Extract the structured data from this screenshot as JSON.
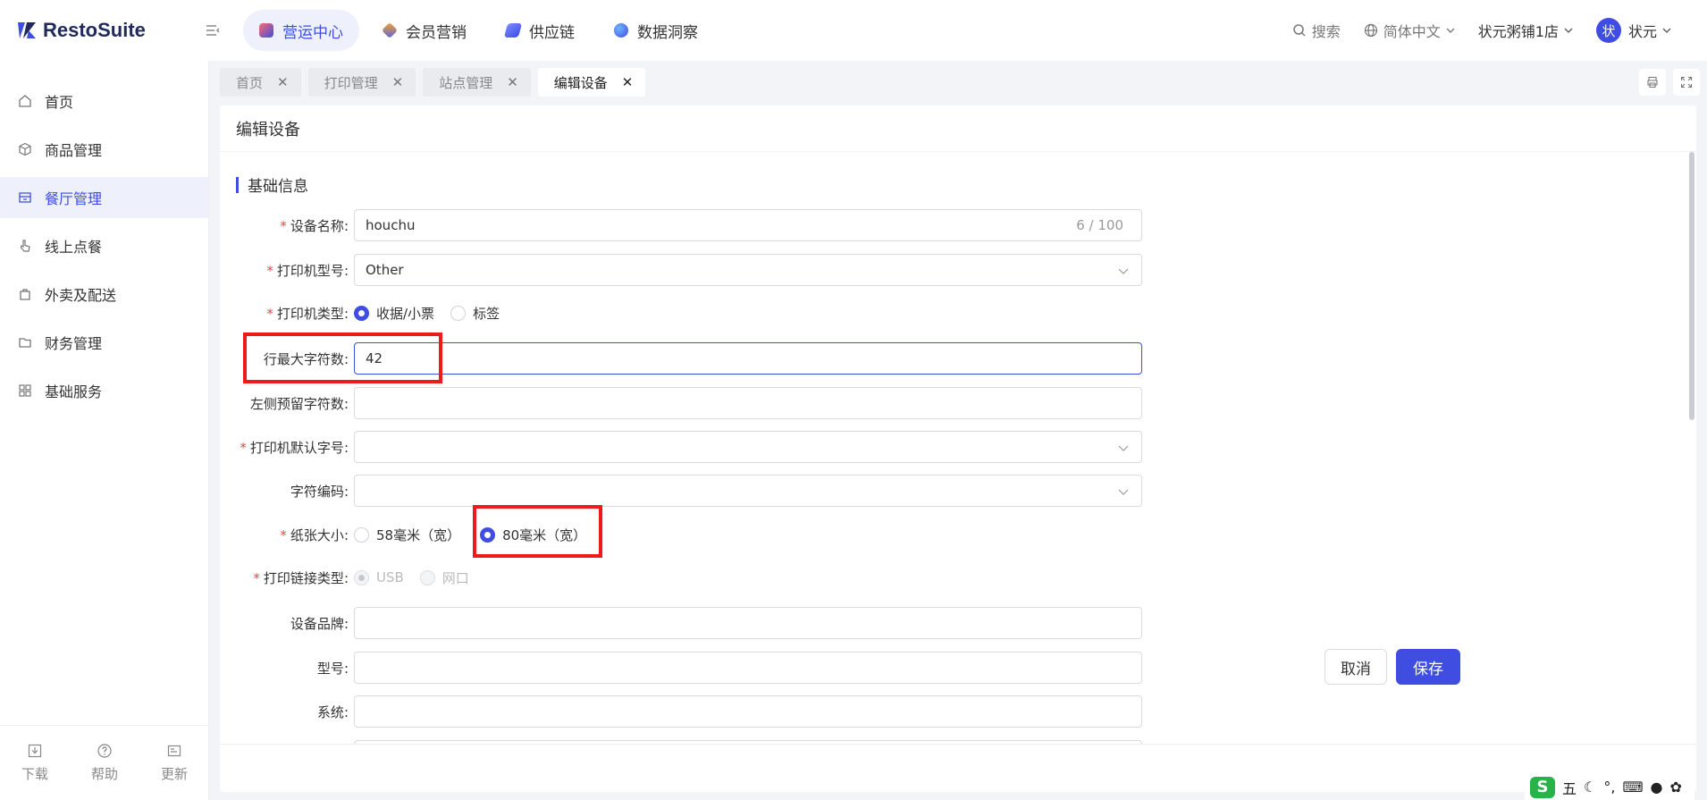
{
  "app": {
    "name": "RestoSuite"
  },
  "topnav": [
    {
      "label": "营运中心",
      "active": true,
      "icon": "operations-icon",
      "color": "#3f4de0"
    },
    {
      "label": "会员营销",
      "active": false,
      "icon": "marketing-icon",
      "color": "#f5a623"
    },
    {
      "label": "供应链",
      "active": false,
      "icon": "supply-chain-icon",
      "color": "#5b62e6"
    },
    {
      "label": "数据洞察",
      "active": false,
      "icon": "data-insight-icon",
      "color": "#3f7be0"
    }
  ],
  "header_right": {
    "search": "搜索",
    "language": "简体中文",
    "store": "状元粥铺1店",
    "avatar_initial": "状",
    "user": "状元"
  },
  "sidebar": {
    "items": [
      {
        "label": "首页",
        "icon": "home-icon",
        "active": false
      },
      {
        "label": "商品管理",
        "icon": "cube-icon",
        "active": false
      },
      {
        "label": "餐厅管理",
        "icon": "store-icon",
        "active": true
      },
      {
        "label": "线上点餐",
        "icon": "pointer-icon",
        "active": false
      },
      {
        "label": "外卖及配送",
        "icon": "bag-icon",
        "active": false
      },
      {
        "label": "财务管理",
        "icon": "folder-icon",
        "active": false
      },
      {
        "label": "基础服务",
        "icon": "grid-icon",
        "active": false
      }
    ],
    "bottom": [
      {
        "label": "下载",
        "icon": "download-icon"
      },
      {
        "label": "帮助",
        "icon": "help-icon"
      },
      {
        "label": "更新",
        "icon": "update-icon"
      }
    ]
  },
  "tabs": [
    {
      "label": "首页",
      "active": false
    },
    {
      "label": "打印管理",
      "active": false
    },
    {
      "label": "站点管理",
      "active": false
    },
    {
      "label": "编辑设备",
      "active": true
    }
  ],
  "page": {
    "title": "编辑设备",
    "section": "基础信息"
  },
  "form": {
    "device_name": {
      "label": "设备名称",
      "required": true,
      "value": "houchu",
      "count": "6 / 100"
    },
    "printer_model": {
      "label": "打印机型号",
      "required": true,
      "value": "Other"
    },
    "printer_type": {
      "label": "打印机类型",
      "required": true,
      "options": [
        "收据/小票",
        "标签"
      ],
      "selected": "收据/小票"
    },
    "max_chars": {
      "label": "行最大字符数",
      "required": false,
      "value": "42"
    },
    "left_reserved": {
      "label": "左侧预留字符数",
      "required": false,
      "value": ""
    },
    "default_font": {
      "label": "打印机默认字号",
      "required": true,
      "value": ""
    },
    "encoding": {
      "label": "字符编码",
      "required": false,
      "value": ""
    },
    "paper_size": {
      "label": "纸张大小",
      "required": true,
      "options": [
        "58毫米（宽）",
        "80毫米（宽）"
      ],
      "selected": "80毫米（宽）"
    },
    "connection_type": {
      "label": "打印链接类型",
      "required": true,
      "options": [
        "USB",
        "网口"
      ],
      "selected": "USB",
      "disabled": true
    },
    "brand": {
      "label": "设备品牌",
      "required": false,
      "value": ""
    },
    "model": {
      "label": "型号",
      "required": false,
      "value": ""
    },
    "system": {
      "label": "系统",
      "required": false,
      "value": ""
    }
  },
  "footer": {
    "cancel": "取消",
    "save": "保存"
  },
  "ime": {
    "mode": "五",
    "punct": "°,"
  },
  "colors": {
    "accent": "#3f4de0",
    "required": "#e5484d",
    "annotation": "#ee1b1b"
  }
}
